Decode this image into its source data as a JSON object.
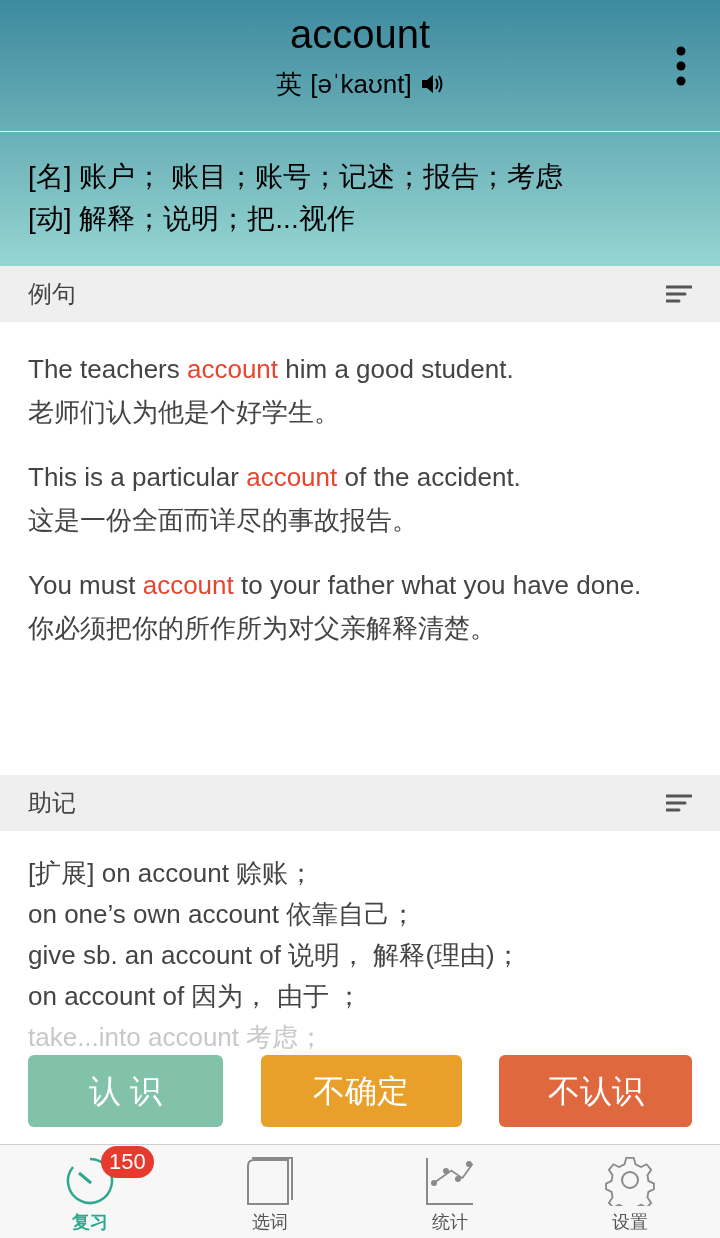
{
  "header": {
    "word": "account",
    "accent": "英",
    "phonetic": "[əˈkaʊnt]"
  },
  "definitions": [
    "[名] 账户； 账目；账号；记述；报告；考虑",
    "[动] 解释；说明；把...视作"
  ],
  "sections": [
    {
      "title": "例句",
      "kind": "examples",
      "examples": [
        {
          "before": "The teachers ",
          "keyword": "account",
          "after": " him a good student.",
          "translation": "老师们认为他是个好学生。"
        },
        {
          "before": "This is a particular ",
          "keyword": "account",
          "after": " of the accident.",
          "translation": "这是一份全面而详尽的事故报告。"
        },
        {
          "before": "You must ",
          "keyword": "account",
          "after": " to your father what you have done.",
          "translation": "你必须把你的所作所为对父亲解释清楚。"
        }
      ]
    },
    {
      "title": "助记",
      "kind": "notes",
      "lines": [
        "[扩展] on account 赊账；",
        "on one’s own account 依靠自己；",
        "give sb. an account of 说明， 解释(理由)；",
        "on account of 因为， 由于 ；",
        "take...into account 考虑；"
      ]
    }
  ],
  "answers": [
    {
      "label": "认 识",
      "color": "#82c2aa"
    },
    {
      "label": "不确定",
      "color": "#e8a02a"
    },
    {
      "label": "不认识",
      "color": "#df683e"
    }
  ],
  "tabs": [
    {
      "label": "复习",
      "kind": "review",
      "selected": true,
      "badge": "150"
    },
    {
      "label": "选词",
      "kind": "book",
      "selected": false
    },
    {
      "label": "统计",
      "kind": "chart",
      "selected": false
    },
    {
      "label": "设置",
      "kind": "gear",
      "selected": false
    }
  ]
}
